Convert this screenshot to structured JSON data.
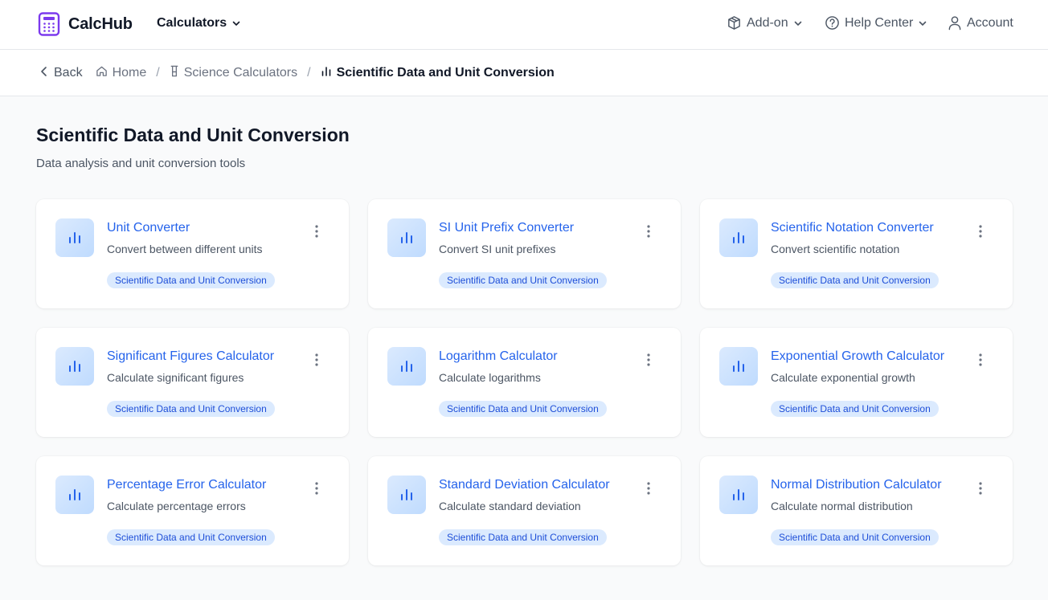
{
  "header": {
    "brand": "CalcHub",
    "nav_calculators": "Calculators",
    "nav_addon": "Add-on",
    "nav_help": "Help Center",
    "nav_account": "Account"
  },
  "breadcrumb": {
    "back": "Back",
    "home": "Home",
    "science": "Science Calculators",
    "current": "Scientific Data and Unit Conversion"
  },
  "page": {
    "title": "Scientific Data and Unit Conversion",
    "subtitle": "Data analysis and unit conversion tools"
  },
  "cards": [
    {
      "title": "Unit Converter",
      "description": "Convert between different units",
      "tag": "Scientific Data and Unit Conversion",
      "icon": "bar-chart-icon"
    },
    {
      "title": "SI Unit Prefix Converter",
      "description": "Convert SI unit prefixes",
      "tag": "Scientific Data and Unit Conversion",
      "icon": "bar-chart-icon"
    },
    {
      "title": "Scientific Notation Converter",
      "description": "Convert scientific notation",
      "tag": "Scientific Data and Unit Conversion",
      "icon": "bar-chart-icon"
    },
    {
      "title": "Significant Figures Calculator",
      "description": "Calculate significant figures",
      "tag": "Scientific Data and Unit Conversion",
      "icon": "bar-chart-icon"
    },
    {
      "title": "Logarithm Calculator",
      "description": "Calculate logarithms",
      "tag": "Scientific Data and Unit Conversion",
      "icon": "bar-chart-icon"
    },
    {
      "title": "Exponential Growth Calculator",
      "description": "Calculate exponential growth",
      "tag": "Scientific Data and Unit Conversion",
      "icon": "bar-chart-icon"
    },
    {
      "title": "Percentage Error Calculator",
      "description": "Calculate percentage errors",
      "tag": "Scientific Data and Unit Conversion",
      "icon": "bar-chart-icon"
    },
    {
      "title": "Standard Deviation Calculator",
      "description": "Calculate standard deviation",
      "tag": "Scientific Data and Unit Conversion",
      "icon": "bar-chart-icon"
    },
    {
      "title": "Normal Distribution Calculator",
      "description": "Calculate normal distribution",
      "tag": "Scientific Data and Unit Conversion",
      "icon": "bar-chart-icon"
    }
  ],
  "colors": {
    "brand_purple": "#7c3aed",
    "link_blue": "#2563eb",
    "tag_bg": "#dbeafe",
    "tag_text": "#1d4ed8"
  }
}
